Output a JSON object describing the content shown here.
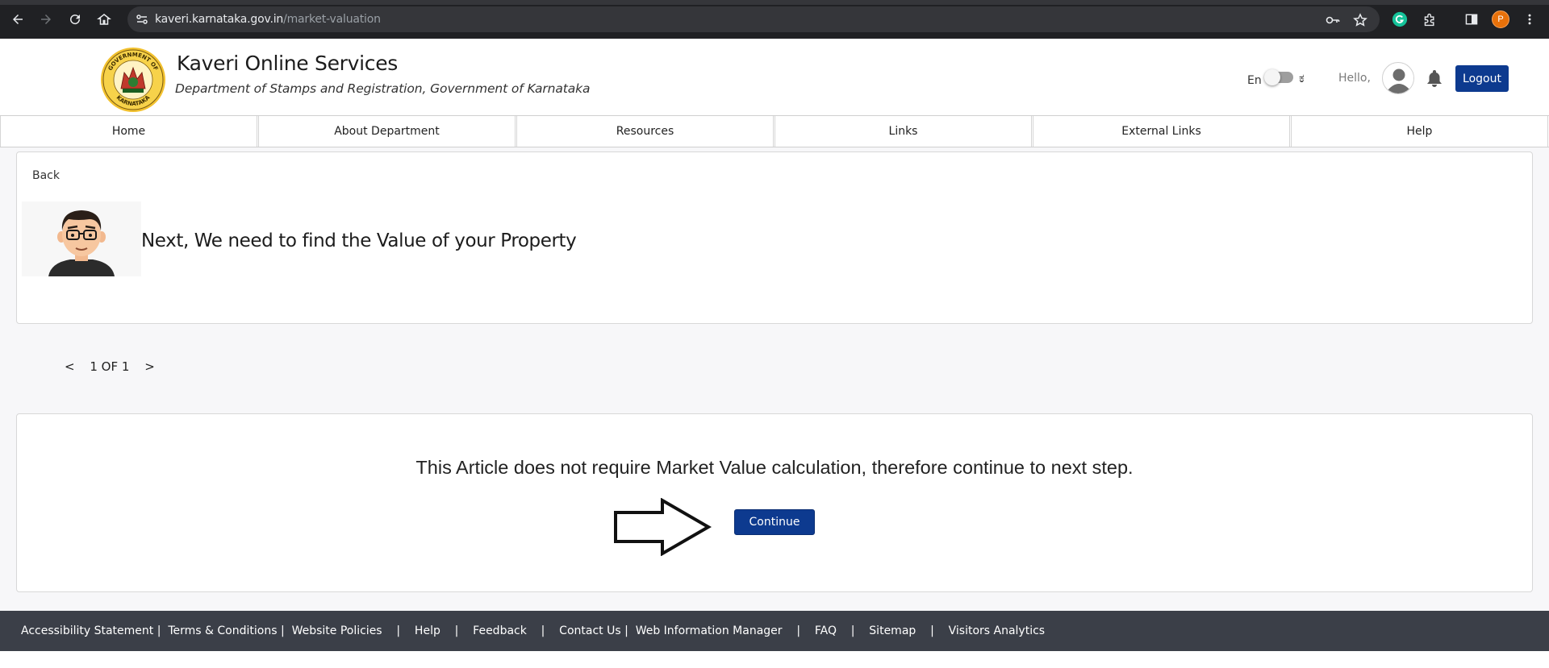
{
  "browser": {
    "url_host": "kaveri.karnataka.gov.in",
    "url_path": "/market-valuation",
    "profile_initial": "P"
  },
  "header": {
    "title": "Kaveri Online Services",
    "subtitle": "Department of Stamps and Registration, Government of Karnataka",
    "emblem_top_text": "GOVERNMENT OF",
    "emblem_bottom_text": "KARNATAKA",
    "lang_en": "En",
    "lang_kn": "ಕ",
    "greeting": "Hello,",
    "logout_label": "Logout"
  },
  "nav": {
    "items": [
      "Home",
      "About Department",
      "Resources",
      "Links",
      "External Links",
      "Help"
    ]
  },
  "main": {
    "back_label": "Back",
    "heading": "Next, We need to find the Value of your Property",
    "pager": {
      "prev": "<",
      "label": "1 OF 1",
      "next": ">"
    },
    "notice": "This Article does not require Market Value calculation, therefore continue to next step.",
    "continue_label": "Continue"
  },
  "footer": {
    "links": [
      "Accessibility Statement |  ",
      "Terms & Conditions |  ",
      "Website Policies    |    ",
      "Help    |    ",
      "Feedback    |    ",
      "Contact Us |  ",
      "Web Information Manager    |    ",
      "FAQ    |    ",
      "Sitemap    |    ",
      "Visitors Analytics"
    ]
  },
  "colors": {
    "brand_blue": "#0d3a8f",
    "footer_bg": "#3b3f48",
    "chrome_bg": "#202124"
  }
}
